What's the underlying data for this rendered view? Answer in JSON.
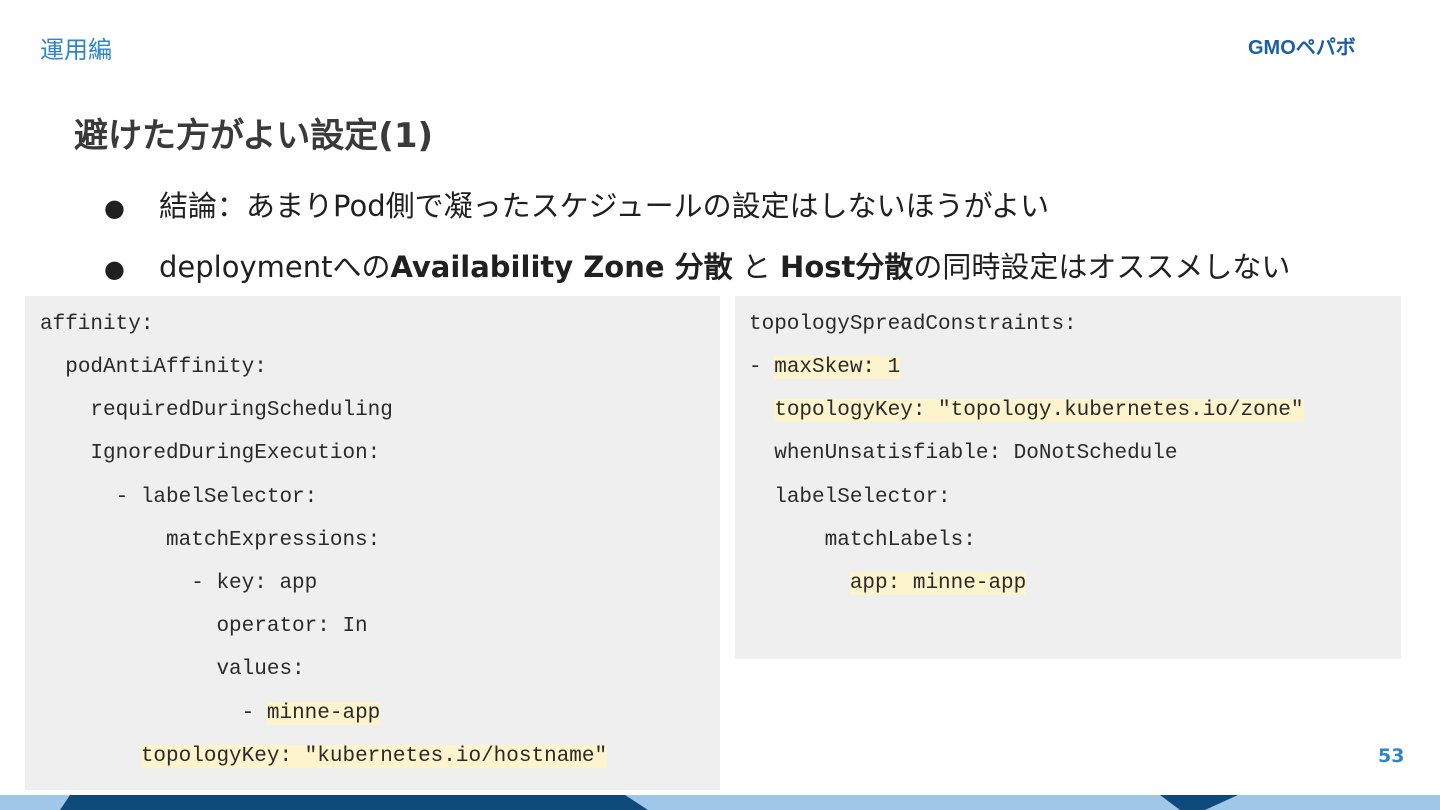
{
  "header": {
    "section_label": "運用編",
    "logo_text": "GMOペパボ"
  },
  "slide": {
    "title": "避けた方がよい設定(1)",
    "bullets": [
      {
        "marker": "●",
        "text": "結論：あまりPod側で凝ったスケジュールの設定はしないほうがよい"
      },
      {
        "marker": "●",
        "prefix": "deploymentへの",
        "bold1": "Availability Zone 分散",
        "middle": " と ",
        "bold2": "Host分散",
        "suffix": "の同時設定はオススメしない"
      }
    ],
    "page_number": "53"
  },
  "code_left": {
    "lines": [
      {
        "indent": "",
        "text": "affinity:"
      },
      {
        "indent": "  ",
        "text": "podAntiAffinity:"
      },
      {
        "indent": "    ",
        "text": "requiredDuringScheduling"
      },
      {
        "indent": "    ",
        "text": "IgnoredDuringExecution:"
      },
      {
        "indent": "      ",
        "text": "- labelSelector:"
      },
      {
        "indent": "          ",
        "text": "matchExpressions:"
      },
      {
        "indent": "            ",
        "text": "- key: app"
      },
      {
        "indent": "              ",
        "text": "operator: In"
      },
      {
        "indent": "              ",
        "text": "values:"
      },
      {
        "indent": "                ",
        "pre": "- ",
        "text": "minne-app"
      },
      {
        "indent": "        ",
        "text": "topologyKey: \"kubernetes.io/hostname\""
      }
    ]
  },
  "code_right": {
    "lines": [
      {
        "indent": "",
        "text": "topologySpreadConstraints:"
      },
      {
        "indent": "",
        "pre": "- ",
        "text": "maxSkew: 1"
      },
      {
        "indent": "  ",
        "text": "topologyKey: \"topology.kubernetes.io/zone\""
      },
      {
        "indent": "  ",
        "text": "whenUnsatisfiable: DoNotSchedule"
      },
      {
        "indent": "  ",
        "text": "labelSelector:"
      },
      {
        "indent": "      ",
        "text": "matchLabels:"
      },
      {
        "indent": "        ",
        "text": "app: minne-app"
      }
    ]
  },
  "colors": {
    "accent": "#2e86c8",
    "highlight": "#fdf3cc",
    "code_background": "#efefef",
    "footer_light": "#9fc7ea",
    "footer_dark": "#0e4a7c"
  }
}
